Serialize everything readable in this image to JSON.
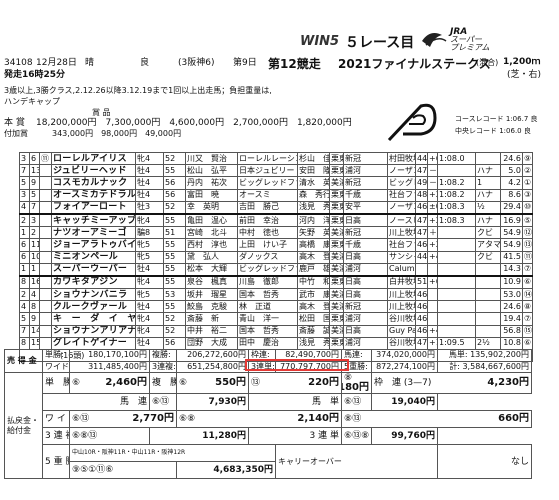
{
  "header": {
    "brand_win5": "WIN5",
    "race_title": "５レース目",
    "brand_jra": "JRA",
    "brand_jra_sub": "スーパー\nプレミアム"
  },
  "race": {
    "id": "34108",
    "date": "12月28日",
    "weather": "晴",
    "track": "良",
    "venue_code": "(3阪神6)",
    "day": "第9日",
    "race_no": "第12競走",
    "race_name": "2021ファイナルステークス",
    "race_type": "(混合)",
    "distance": "1,200",
    "distance_unit": "ｍ",
    "surface": "(芝・右)",
    "post_time": "発走16時25分",
    "conditions": "3歳以上,3勝クラス,2.12.26以降3.12.19まで1回以上出走馬；負担重量は,",
    "conditions2": "ハンデキャップ",
    "prize_label": "賞 品",
    "honsho_label": "本 賞",
    "prizes": "18,200,000円　7,300,000円　4,600,000円　2,700,000円　1,820,000円",
    "fuka_label": "付加賞",
    "fuka_prizes": "343,000円　98,000円　49,000円",
    "course_record": "コースレコード 1:06.7 良",
    "chuo_record": "中央レコード 1:06.0 良"
  },
  "horses": [
    {
      "waku": "3",
      "num": "6",
      "mark": "⑪",
      "name": "ローレルアイリス",
      "sex": "牝4",
      "age": "栗",
      "wt": "52",
      "jockey": "川又　賢治",
      "owner": "ローレルレーシング",
      "trainer": "杉山　佳明",
      "reg": "栗東",
      "breeder": "新冠",
      "farm": "村田牧場",
      "bw": "446",
      "diff": "+",
      "d2": "6",
      "time": "1:08.0",
      "margin": "",
      "last3": "",
      "odds": "24.6",
      "pop": "⑨"
    },
    {
      "waku": "7",
      "num": "13",
      "mark": "",
      "name": "ジュビリーヘッド",
      "sex": "牡4",
      "age": "鹿",
      "wt": "55",
      "jockey": "松山　弘平",
      "owner": "日本ジュビリー",
      "trainer": "安田　隆行",
      "reg": "栗東",
      "breeder": "浦河",
      "farm": "ノーザンファーム",
      "bw": "472",
      "diff": "－",
      "d2": "2",
      "time": "",
      "margin": "ハナ",
      "last3": "",
      "odds": "5.0",
      "pop": "②"
    },
    {
      "waku": "5",
      "num": "9",
      "mark": "",
      "name": "コスモカルナック",
      "sex": "牡4",
      "age": "鹿",
      "wt": "56",
      "jockey": "丹内　祐次",
      "owner": "ビッグレッドファーム",
      "trainer": "清水　英克",
      "reg": "美浦",
      "breeder": "新冠",
      "farm": "ビッグレッドF",
      "bw": "494",
      "diff": "－",
      "d2": "2",
      "time": "1:08.2",
      "margin": "1",
      "last3": "",
      "odds": "4.2",
      "pop": "①"
    },
    {
      "waku": "3",
      "num": "5",
      "mark": "",
      "name": "オースミカテドラル",
      "sex": "牡4",
      "age": "黒",
      "wt": "56",
      "jockey": "富田　暁",
      "owner": "オースミ",
      "trainer": "森　秀行",
      "reg": "栗東",
      "breeder": "千歳",
      "farm": "社台ファーム",
      "bw": "482",
      "diff": "+",
      "d2": "2",
      "time": "1:08.2",
      "margin": "ハナ",
      "last3": "",
      "odds": "8.6",
      "pop": "③"
    },
    {
      "waku": "4",
      "num": "7",
      "mark": "",
      "name": "フォイアーロート",
      "sex": "牡3",
      "age": "鹿",
      "wt": "52",
      "jockey": "幸　英明",
      "owner": "吉田　勝己",
      "trainer": "浅見　秀一",
      "reg": "栗東",
      "breeder": "安平",
      "farm": "ノーザンファーム",
      "bw": "462",
      "diff": "±",
      "d2": "0",
      "time": "1:08.3",
      "margin": "½",
      "last3": "",
      "odds": "29.4",
      "pop": "⑩"
    },
    {
      "waku": "2",
      "num": "3",
      "mark": "",
      "name": "キャッチミーアップ",
      "sex": "牝4",
      "age": "芦",
      "wt": "55",
      "jockey": "亀田　温心",
      "owner": "前田　幸治",
      "trainer": "河内　洋",
      "reg": "栗東",
      "breeder": "日高",
      "farm": "ノースヒルズ",
      "bw": "478",
      "diff": "+",
      "d2": "2",
      "time": "1:08.3",
      "margin": "ハナ",
      "last3": "",
      "odds": "16.9",
      "pop": "⑤"
    },
    {
      "waku": "1",
      "num": "2",
      "mark": "",
      "name": "ナツオーアミーゴ",
      "sex": "騙8",
      "age": "栗",
      "wt": "51",
      "jockey": "宮崎　北斗",
      "owner": "中村　徳也",
      "trainer": "矢野　英一",
      "reg": "美浦",
      "breeder": "新冠",
      "farm": "川上牧場",
      "bw": "478",
      "diff": "＋",
      "d2": "4",
      "time": "",
      "margin": "クビ",
      "last3": "",
      "odds": "54.9",
      "pop": "⑫"
    },
    {
      "waku": "6",
      "num": "11",
      "mark": "",
      "name": "ジョーアラトゥバイ",
      "sex": "牝5",
      "age": "鹿",
      "wt": "55",
      "jockey": "西村　淳也",
      "owner": "上田　けい子",
      "trainer": "高橋　康之",
      "reg": "栗東",
      "breeder": "千歳",
      "farm": "社台ファーム",
      "bw": "468",
      "diff": "+",
      "d2": "20",
      "time": "",
      "margin": "アタマ",
      "last3": "",
      "odds": "54.9",
      "pop": "⑬"
    },
    {
      "waku": "6",
      "num": "10",
      "mark": "",
      "name": "ミニオンペール",
      "sex": "牝5",
      "age": "鹿",
      "wt": "55",
      "jockey": "黛　弘人",
      "owner": "ダノックス",
      "trainer": "高木　登",
      "reg": "美浦",
      "breeder": "日高",
      "farm": "サンシャイン",
      "bw": "442",
      "diff": "+",
      "d2": "4",
      "time": "",
      "margin": "クビ",
      "last3": "",
      "odds": "41.5",
      "pop": "⑪"
    },
    {
      "waku": "1",
      "num": "1",
      "mark": "",
      "name": "スーパーウーパー",
      "sex": "牡4",
      "age": "芦",
      "wt": "55",
      "jockey": "松本　大輝",
      "owner": "ビッグレッドファーム",
      "trainer": "鹿戸　雄一",
      "reg": "美浦",
      "breeder": "浦河",
      "farm": "Calumet Farm",
      "bw": "",
      "diff": "",
      "d2": "",
      "time": "",
      "margin": "",
      "last3": "",
      "odds": "14.3",
      "pop": "⑦"
    },
    {
      "waku": "8",
      "num": "16",
      "mark": "",
      "name": "カワキタアジン",
      "sex": "牝4",
      "age": "鹿",
      "wt": "55",
      "jockey": "泉谷　楓真",
      "owner": "川島　徹郎",
      "trainer": "中竹　和也",
      "reg": "栗東",
      "breeder": "日高",
      "farm": "白井牧場",
      "bw": "514",
      "diff": "+",
      "d2": "6",
      "time": "",
      "margin": "",
      "last3": "",
      "odds": "10.9",
      "pop": "⑥"
    },
    {
      "waku": "2",
      "num": "4",
      "mark": "",
      "name": "ショウナンバニラ",
      "sex": "牝5",
      "age": "鹿",
      "wt": "53",
      "jockey": "坂井　瑠星",
      "owner": "国本　哲秀",
      "trainer": "武市　康男",
      "reg": "美浦",
      "breeder": "日高",
      "farm": "川上牧場",
      "bw": "466",
      "diff": "",
      "d2": "",
      "time": "",
      "margin": "",
      "last3": "",
      "odds": "53.0",
      "pop": "⑭"
    },
    {
      "waku": "4",
      "num": "8",
      "mark": "",
      "name": "クルークヴァール",
      "sex": "牡4",
      "age": "鹿",
      "wt": "55",
      "jockey": "鮫島　克駿",
      "owner": "林　正道",
      "trainer": "高木　登",
      "reg": "美浦",
      "breeder": "新冠",
      "farm": "川上牧場",
      "bw": "462",
      "diff": "",
      "d2": "",
      "time": "",
      "margin": "",
      "last3": "",
      "odds": "24.6",
      "pop": "⑧"
    },
    {
      "waku": "5",
      "num": "9",
      "mark": "",
      "name": "キ　ー　ダ　イ　ヤ",
      "sex": "牝4",
      "age": "鹿",
      "wt": "52",
      "jockey": "斎藤　新",
      "owner": "青山　洋一",
      "trainer": "松田　国英",
      "reg": "栗東",
      "breeder": "浦河",
      "farm": "谷川牧場",
      "bw": "464",
      "diff": "",
      "d2": "",
      "time": "",
      "margin": "",
      "last3": "",
      "odds": "19.4",
      "pop": "⑦"
    },
    {
      "waku": "7",
      "num": "14",
      "mark": "",
      "name": "ショウナンアリアナ",
      "sex": "牝4",
      "age": "鹿",
      "wt": "52",
      "jockey": "中井　裕二",
      "owner": "国本　哲秀",
      "trainer": "斎藤　誠",
      "reg": "美浦",
      "breeder": "日高",
      "farm": "Guy Pari-ente Holding",
      "bw": "466",
      "diff": "+",
      "d2": "4",
      "time": "",
      "margin": "",
      "last3": "",
      "odds": "56.8",
      "pop": "⑮"
    },
    {
      "waku": "8",
      "num": "15",
      "mark": "",
      "name": "グレイトゲイナー",
      "sex": "牡4",
      "age": "青鹿",
      "wt": "56",
      "jockey": "団野　大成",
      "owner": "田中　慶治",
      "trainer": "浅見　秀一",
      "reg": "栗東",
      "breeder": "浦河",
      "farm": "谷川牧場",
      "bw": "478",
      "diff": "+",
      "d2": "14",
      "time": "1:09.5",
      "margin": "2½",
      "last3": "",
      "odds": "10.8",
      "pop": "⑥"
    }
  ],
  "horse_count": "(16頭)",
  "sales": {
    "label": "売 得 金",
    "row1": [
      [
        "単勝:",
        "180,170,100円"
      ],
      [
        "複勝:",
        "206,272,600円"
      ],
      [
        "枠連:",
        "82,490,700円"
      ],
      [
        "馬連:",
        "374,020,000円"
      ],
      [
        "馬単:",
        "135,902,200円"
      ]
    ],
    "row2": [
      [
        "ワイド:",
        "311,485,400円"
      ],
      [
        "3連複:",
        "651,254,800円"
      ],
      [
        "3連単:",
        "770,797,700円"
      ],
      [
        "5重勝:",
        "872,274,100円"
      ],
      [
        "計:",
        "3,584,667,600円"
      ]
    ]
  },
  "payout": {
    "label": "払戻金・給付金",
    "tansho_label": "単　勝",
    "tansho_num": "⑥",
    "tansho_amt": "2,460円",
    "fukusho_label": "複　勝",
    "fukusho": [
      [
        "⑥",
        "550円"
      ],
      [
        "⑬",
        "220円"
      ],
      [
        "⑧",
        "180円"
      ]
    ],
    "wakuren_label": "枠　連",
    "wakuren_num": "(3—7)",
    "wakuren_amt": "4,230円",
    "umaren_label": "馬　連",
    "umaren_num": "⑥⑬",
    "umaren_amt": "7,930円",
    "umatan_label": "馬　単",
    "umatan_num": "⑥⑬",
    "umatan_amt": "19,040円",
    "wide_label": "ワ イ ド",
    "wide": [
      [
        "⑥⑬",
        "2,770円"
      ],
      [
        "⑥⑧",
        "2,140円"
      ],
      [
        "⑧⑬",
        "660円"
      ]
    ],
    "sanrenpuku_label": "3 連 複",
    "sanrenpuku_num": "⑥⑧⑬",
    "sanrenpuku_amt": "11,280円",
    "sanrentan_label": "3 連 単",
    "sanrentan_num": "⑥⑬⑧",
    "sanrentan_amt": "99,760円",
    "win5_label": "5 重 勝",
    "win5_nums": "⑨⑤①⑪⑥",
    "win5_amt": "4,683,350円",
    "win5_note": "中山10R・阪神11R・中山11R・阪神12R",
    "carryover_label": "キャリーオーバー",
    "carryover_val": "なし"
  }
}
